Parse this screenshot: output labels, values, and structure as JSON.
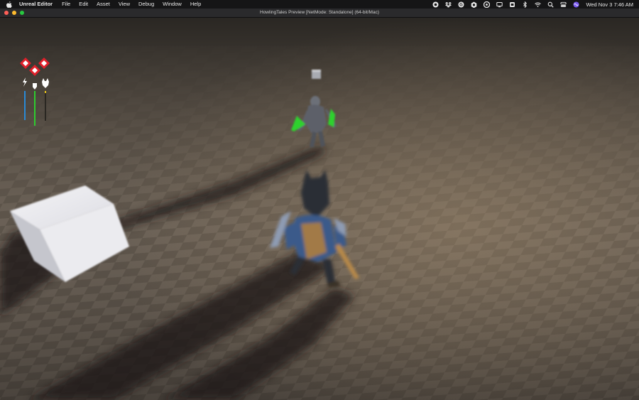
{
  "menubar": {
    "apple_icon": "apple-icon",
    "items": [
      "Unreal Editor",
      "File",
      "Edit",
      "Asset",
      "View",
      "Debug",
      "Window",
      "Help"
    ],
    "status_icons": [
      "record-icon",
      "dropbox-icon",
      "grammarly-icon",
      "unreal-icon",
      "creative-cloud-icon",
      "display-icon",
      "shield-icon",
      "bluetooth-icon",
      "wifi-icon",
      "search-icon",
      "control-center-icon",
      "siri-icon"
    ],
    "clock": "Wed Nov 3  7:46 AM"
  },
  "window": {
    "title": "HowlingTales Preview [NetMode: Standalone]  (64-bit/Mac)",
    "traffic_lights": {
      "close": "#ff5f57",
      "minimize": "#febc2e",
      "maximize": "#28c840"
    }
  },
  "hud": {
    "hearts": 3,
    "heart_color": "#e0202a",
    "bars": [
      {
        "icon": "lightning-icon",
        "color": "#2a8ad6"
      },
      {
        "icon": "shield-icon",
        "color": "#2ecc2e"
      },
      {
        "icon": "wolf-icon",
        "color": "#e6c21a"
      }
    ]
  }
}
